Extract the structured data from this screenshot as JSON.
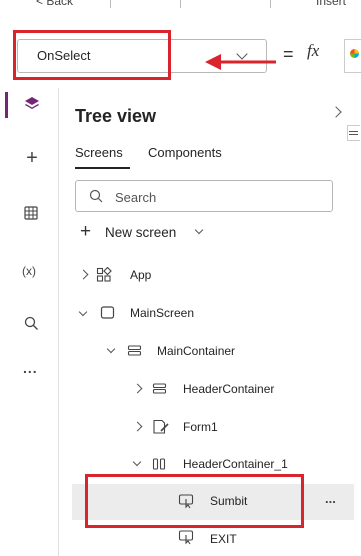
{
  "toolbar": {
    "back_label": "Back",
    "insert_label": "Insert"
  },
  "formula": {
    "property_value": "OnSelect",
    "equals": "=",
    "fx": "fx"
  },
  "tree": {
    "title": "Tree view",
    "tabs": [
      "Screens",
      "Components"
    ],
    "search_placeholder": "Search",
    "new_screen_label": "New screen",
    "nodes": [
      {
        "label": "App"
      },
      {
        "label": "MainScreen"
      },
      {
        "label": "MainContainer"
      },
      {
        "label": "HeaderContainer"
      },
      {
        "label": "Form1"
      },
      {
        "label": "HeaderContainer_1"
      },
      {
        "label": "Sumbit"
      },
      {
        "label": "EXIT"
      }
    ],
    "more_label": "..."
  },
  "rail": {
    "variables_label": "(x)",
    "more_label": "..."
  },
  "colors": {
    "accent": "#742774",
    "annotation": "#d9232d"
  }
}
